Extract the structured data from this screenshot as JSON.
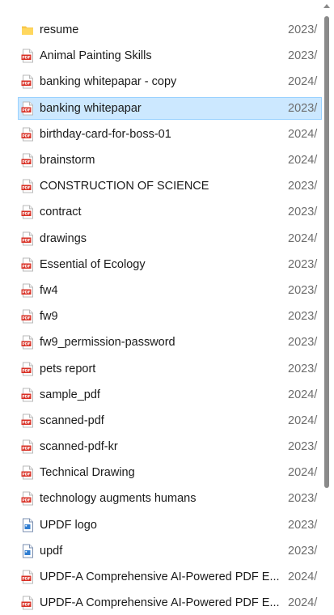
{
  "files": [
    {
      "name": "resume",
      "date": "2023/",
      "type": "folder"
    },
    {
      "name": "Animal Painting Skills",
      "date": "2023/",
      "type": "pdf"
    },
    {
      "name": "banking whitepapar - copy",
      "date": "2024/",
      "type": "pdf"
    },
    {
      "name": "banking whitepapar",
      "date": "2023/",
      "type": "pdf",
      "selected": true
    },
    {
      "name": "birthday-card-for-boss-01",
      "date": "2024/",
      "type": "pdf"
    },
    {
      "name": "brainstorm",
      "date": "2024/",
      "type": "pdf"
    },
    {
      "name": "CONSTRUCTION OF SCIENCE",
      "date": "2023/",
      "type": "pdf"
    },
    {
      "name": "contract",
      "date": "2023/",
      "type": "pdf"
    },
    {
      "name": "drawings",
      "date": "2024/",
      "type": "pdf"
    },
    {
      "name": "Essential of Ecology",
      "date": "2023/",
      "type": "pdf"
    },
    {
      "name": "fw4",
      "date": "2023/",
      "type": "pdf"
    },
    {
      "name": "fw9",
      "date": "2023/",
      "type": "pdf"
    },
    {
      "name": "fw9_permission-password",
      "date": "2023/",
      "type": "pdf"
    },
    {
      "name": "pets report",
      "date": "2023/",
      "type": "pdf"
    },
    {
      "name": "sample_pdf",
      "date": "2024/",
      "type": "pdf"
    },
    {
      "name": "scanned-pdf",
      "date": "2024/",
      "type": "pdf"
    },
    {
      "name": "scanned-pdf-kr",
      "date": "2023/",
      "type": "pdf"
    },
    {
      "name": "Technical Drawing",
      "date": "2024/",
      "type": "pdf"
    },
    {
      "name": "technology augments humans",
      "date": "2023/",
      "type": "pdf"
    },
    {
      "name": "UPDF logo",
      "date": "2023/",
      "type": "image"
    },
    {
      "name": "updf",
      "date": "2023/",
      "type": "image"
    },
    {
      "name": "UPDF-A Comprehensive AI-Powered PDF E...",
      "date": "2024/",
      "type": "pdf"
    },
    {
      "name": "UPDF-A Comprehensive AI-Powered PDF E...",
      "date": "2024/",
      "type": "pdf"
    }
  ],
  "icon_labels": {
    "pdf": "PDF"
  },
  "colors": {
    "selection_bg": "#cce8ff",
    "selection_border": "#99d1ff",
    "pdf_red": "#d93025",
    "folder_yellow": "#f8c74a"
  }
}
